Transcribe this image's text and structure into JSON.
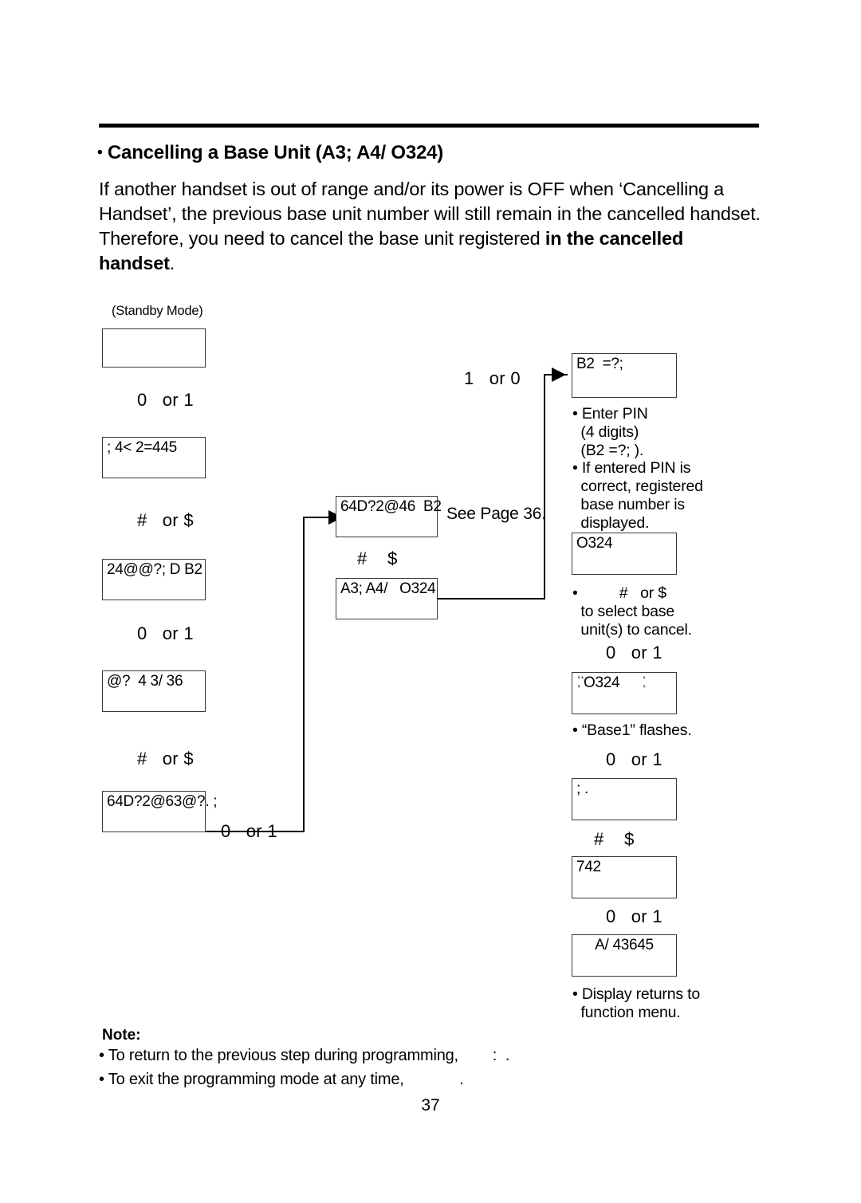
{
  "document": {
    "page_number": "37",
    "heading_bullet": "•",
    "heading": "Cancelling a Base Unit (A3; A4/   O324)",
    "paragraph_1": "If another handset is out of range and/or its power is OFF when ‘Cancelling a Handset’, the previous base unit number will still remain in the cancelled handset.",
    "paragraph_2_lead": "Therefore, you need to cancel the base unit registered ",
    "paragraph_2_bold": "in the cancelled handset",
    "paragraph_2_tail": "."
  },
  "flow": {
    "standby_label": "(Standby Mode)",
    "see_page": "See Page 36.",
    "left_column": {
      "box_1_text": "",
      "key_1": "0   or 1",
      "box_2_text": "; 4< 2=445",
      "key_2": "#   or $",
      "box_3_text": "24@@?; D B2",
      "key_3": "0   or 1",
      "box_4_text": "@?  4 3/ 36",
      "key_4": "#   or $",
      "box_5_text": "64D?2@63@?. ;",
      "key_5": "0   or 1"
    },
    "middle_column": {
      "box_1_text": "64D?2@46  B2",
      "key_1": "#    $",
      "box_2_text": "A3; A4/   O324"
    },
    "right_column": {
      "key_entry": "1   or 0",
      "box_pin_text": "B2  =?;",
      "note_1": "• Enter PIN\n  (4 digits)\n  (B2 =?; ).",
      "note_2": "• If entered PIN is\n  correct, registered\n  base number is\n  displayed.",
      "box_base_text": "O324",
      "note_3": "•          #   or $\n  to select base\n  unit(s) to cancel.",
      "key_2": "0   or 1",
      "box_flash_text": "O324",
      "note_4": "• “Base1” flashes.",
      "key_3": "0   or 1",
      "box_semicolon_text": "; .",
      "key_4": "#    $",
      "box_742_text": "742",
      "key_5": "0   or 1",
      "box_final_text": "A/ 43645",
      "note_5": "• Display returns to\n  function menu."
    }
  },
  "note": {
    "title": "Note:",
    "line_1": "• To return to the previous step during programming,        :  .",
    "line_2": "• To exit the programming mode at any time,             ."
  }
}
